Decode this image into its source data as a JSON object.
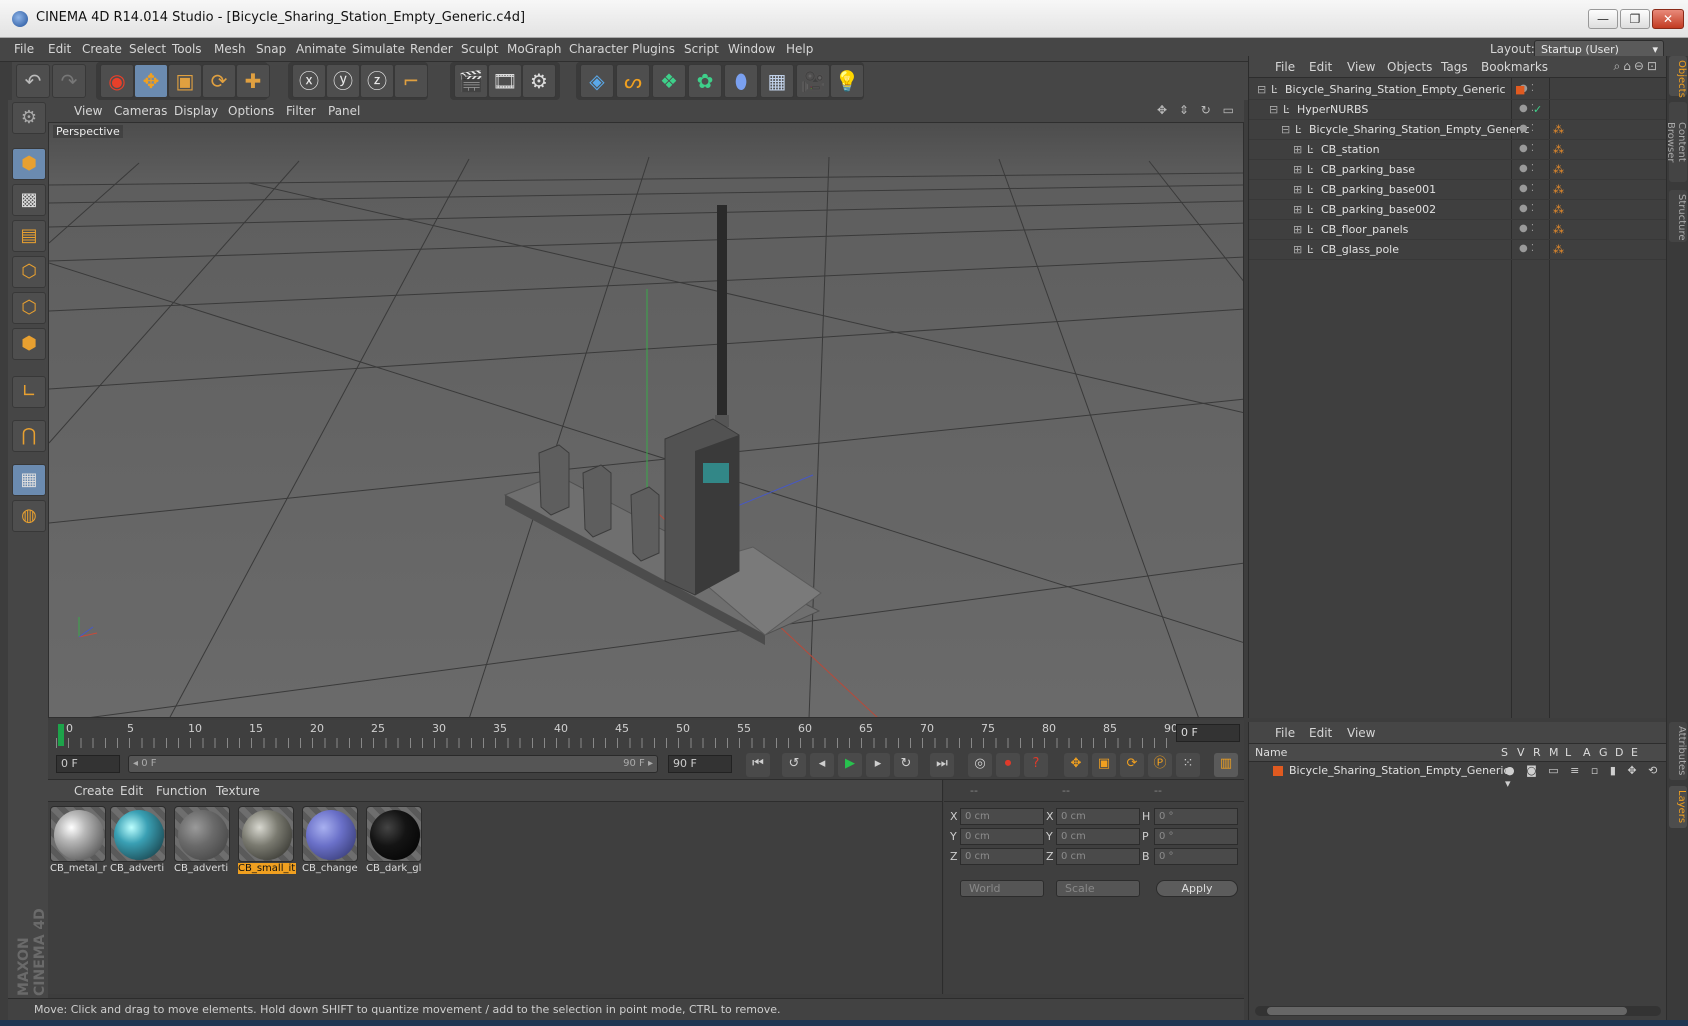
{
  "window": {
    "title": "CINEMA 4D R14.014 Studio - [Bicycle_Sharing_Station_Empty_Generic.c4d]",
    "min": "—",
    "max": "❐",
    "close": "✕"
  },
  "menu": [
    "File",
    "Edit",
    "Create",
    "Select",
    "Tools",
    "Mesh",
    "Snap",
    "Animate",
    "Simulate",
    "Render",
    "Sculpt",
    "MoGraph",
    "Character",
    "Plugins",
    "Script",
    "Window",
    "Help"
  ],
  "layout": {
    "label": "Layout:",
    "value": "Startup (User)"
  },
  "viewport": {
    "menu": [
      "View",
      "Cameras",
      "Display",
      "Options",
      "Filter",
      "Panel"
    ],
    "label": "Perspective",
    "nav_icons": "✥ ⇕ ↻ ▭"
  },
  "timeline": {
    "ticks": [
      "0",
      "5",
      "10",
      "15",
      "20",
      "25",
      "30",
      "35",
      "40",
      "45",
      "50",
      "55",
      "60",
      "65",
      "70",
      "75",
      "80",
      "85",
      "90"
    ],
    "current_frame": "0 F"
  },
  "transport": {
    "start": "0 F",
    "slider_left": "◂ 0 F",
    "slider_right": "90 F ▸",
    "end": "90 F"
  },
  "materials": {
    "menu": [
      "Create",
      "Edit",
      "Function",
      "Texture"
    ],
    "items": [
      {
        "label": "CB_metal_r",
        "color": "#b8b8b8"
      },
      {
        "label": "CB_adverti",
        "color": "#3aa0b4"
      },
      {
        "label": "CB_adverti",
        "color": "#6a6a6a"
      },
      {
        "label": "CB_small_it",
        "color": "#7a7a70"
      },
      {
        "label": "CB_change",
        "color": "#6a70c8"
      },
      {
        "label": "CB_dark_gl",
        "color": "#141414"
      }
    ]
  },
  "coords": {
    "head": [
      "--",
      "--",
      "--"
    ],
    "rows": [
      {
        "a": "X",
        "av": "0 cm",
        "b": "X",
        "bv": "0 cm",
        "c": "H",
        "cv": "0 °"
      },
      {
        "a": "Y",
        "av": "0 cm",
        "b": "Y",
        "bv": "0 cm",
        "c": "P",
        "cv": "0 °"
      },
      {
        "a": "Z",
        "av": "0 cm",
        "b": "Z",
        "bv": "0 cm",
        "c": "B",
        "cv": "0 °"
      }
    ],
    "world": "World",
    "scale": "Scale",
    "apply": "Apply"
  },
  "objects": {
    "menu": [
      "File",
      "Edit",
      "View",
      "Objects",
      "Tags",
      "Bookmarks"
    ],
    "rows": [
      {
        "name": "Bicycle_Sharing_Station_Empty_Generic",
        "indent": 0,
        "tree": "⊟"
      },
      {
        "name": "HyperNURBS",
        "indent": 1,
        "tree": "⊟"
      },
      {
        "name": "Bicycle_Sharing_Station_Empty_Generic",
        "indent": 2,
        "tree": "⊟"
      },
      {
        "name": "CB_station",
        "indent": 3,
        "tree": "⊞"
      },
      {
        "name": "CB_parking_base",
        "indent": 3,
        "tree": "⊞"
      },
      {
        "name": "CB_parking_base001",
        "indent": 3,
        "tree": "⊞"
      },
      {
        "name": "CB_parking_base002",
        "indent": 3,
        "tree": "⊞"
      },
      {
        "name": "CB_floor_panels",
        "indent": 3,
        "tree": "⊞"
      },
      {
        "name": "CB_glass_pole",
        "indent": 3,
        "tree": "⊞"
      }
    ]
  },
  "layers": {
    "menu": [
      "File",
      "Edit",
      "View"
    ],
    "columns": [
      "Name",
      "S",
      "V",
      "R",
      "M",
      "L",
      "A",
      "G",
      "D",
      "E"
    ],
    "row": "Bicycle_Sharing_Station_Empty_Generic"
  },
  "side_tabs": [
    "Objects",
    "Content Browser",
    "Structure",
    "Attributes",
    "Layers"
  ],
  "status": "Move: Click and drag to move elements. Hold down SHIFT to quantize movement / add to the selection in point mode, CTRL to remove.",
  "logo": "MAXON CINEMA 4D"
}
